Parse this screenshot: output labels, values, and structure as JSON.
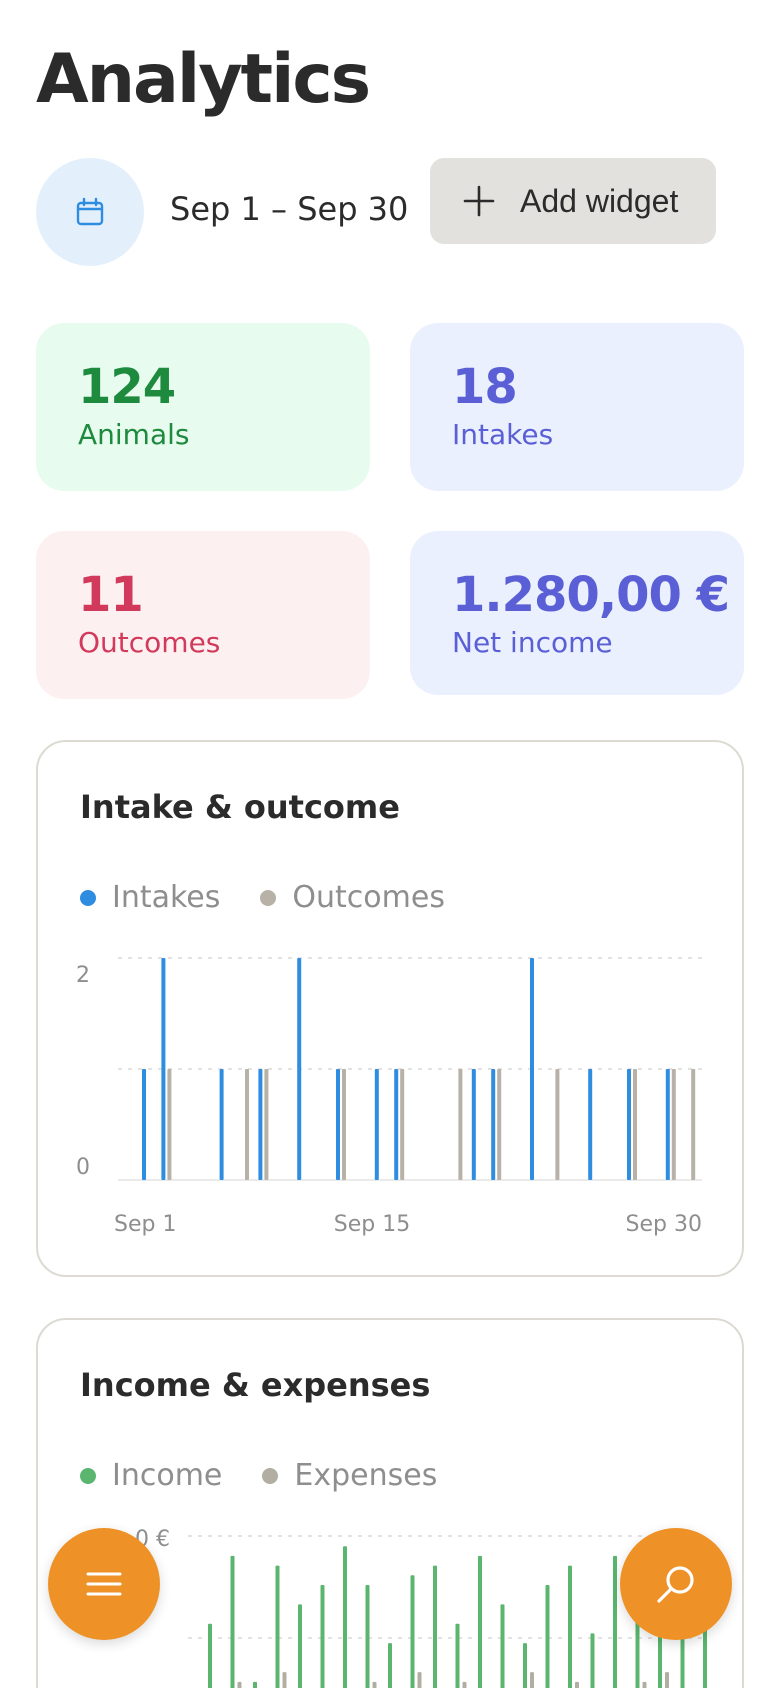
{
  "page": {
    "title": "Analytics"
  },
  "toolbar": {
    "date_range": "Sep 1 – Sep 30",
    "add_widget_label": "Add widget",
    "calendar_icon": "calendar-icon",
    "plus_icon": "plus-icon"
  },
  "stats": [
    {
      "value": "124",
      "label": "Animals",
      "color": "#1d8a3e"
    },
    {
      "value": "18",
      "label": "Intakes",
      "color": "#5a5fd6"
    },
    {
      "value": "11",
      "label": "Outcomes",
      "color": "#d23a5c"
    },
    {
      "value": "1.280,00 €",
      "label": "Net income",
      "color": "#5a5fd6"
    }
  ],
  "intake_chart": {
    "title": "Intake & outcome",
    "legend": [
      {
        "name": "Intakes",
        "color": "#2e8de0"
      },
      {
        "name": "Outcomes",
        "color": "#b7b1a7"
      }
    ]
  },
  "income_chart": {
    "title": "Income & expenses",
    "legend": [
      {
        "name": "Income",
        "color": "#5ab56e"
      },
      {
        "name": "Expenses",
        "color": "#b2afa2"
      }
    ],
    "y_top_label": "0 €"
  },
  "chart_data": [
    {
      "type": "bar",
      "title": "Intake & outcome",
      "x": [
        "Sep 1",
        "Sep 2",
        "Sep 3",
        "Sep 4",
        "Sep 5",
        "Sep 6",
        "Sep 7",
        "Sep 8",
        "Sep 9",
        "Sep 10",
        "Sep 11",
        "Sep 12",
        "Sep 13",
        "Sep 14",
        "Sep 15",
        "Sep 16",
        "Sep 17",
        "Sep 18",
        "Sep 19",
        "Sep 20",
        "Sep 21",
        "Sep 22",
        "Sep 23",
        "Sep 24",
        "Sep 25",
        "Sep 26",
        "Sep 27",
        "Sep 28",
        "Sep 29",
        "Sep 30"
      ],
      "xtick_labels": [
        "Sep 1",
        "Sep 15",
        "Sep 30"
      ],
      "ytick_labels": [
        "0",
        "2"
      ],
      "ylim": [
        0,
        2
      ],
      "grid": true,
      "series": [
        {
          "name": "Intakes",
          "color": "#2e8de0",
          "values": [
            1,
            2,
            0,
            0,
            1,
            0,
            1,
            0,
            2,
            0,
            1,
            0,
            1,
            1,
            0,
            0,
            0,
            1,
            1,
            0,
            2,
            0,
            0,
            1,
            0,
            1,
            0,
            1,
            0,
            0
          ]
        },
        {
          "name": "Outcomes",
          "color": "#b7b1a7",
          "values": [
            0,
            1,
            0,
            0,
            0,
            1,
            1,
            0,
            0,
            0,
            1,
            0,
            0,
            1,
            0,
            0,
            1,
            0,
            1,
            0,
            0,
            1,
            0,
            0,
            0,
            1,
            0,
            1,
            1,
            0
          ]
        }
      ]
    },
    {
      "type": "bar",
      "title": "Income & expenses",
      "ytick_labels": [
        "0 €"
      ],
      "grid": true,
      "series": [
        {
          "name": "Income",
          "color": "#5ab56e",
          "values": [
            0.6,
            0.95,
            0.3,
            0.9,
            0.7,
            0.8,
            1.0,
            0.8,
            0.5,
            0.85,
            0.9,
            0.6,
            0.95,
            0.7,
            0.5,
            0.8,
            0.9,
            0.55,
            0.95,
            0.8,
            0.6,
            0.85,
            0.7
          ]
        },
        {
          "name": "Expenses",
          "color": "#b2afa2",
          "values": [
            0.2,
            0.3,
            0.1,
            0.35,
            0.25,
            0.2,
            0.15,
            0.3,
            0.2,
            0.35,
            0.1,
            0.3,
            0.25,
            0.2,
            0.35,
            0.15,
            0.3,
            0.25,
            0.2,
            0.3,
            0.35,
            0.15,
            0.25
          ]
        }
      ]
    }
  ],
  "fabs": {
    "menu_icon": "menu-icon",
    "search_icon": "search-icon"
  }
}
